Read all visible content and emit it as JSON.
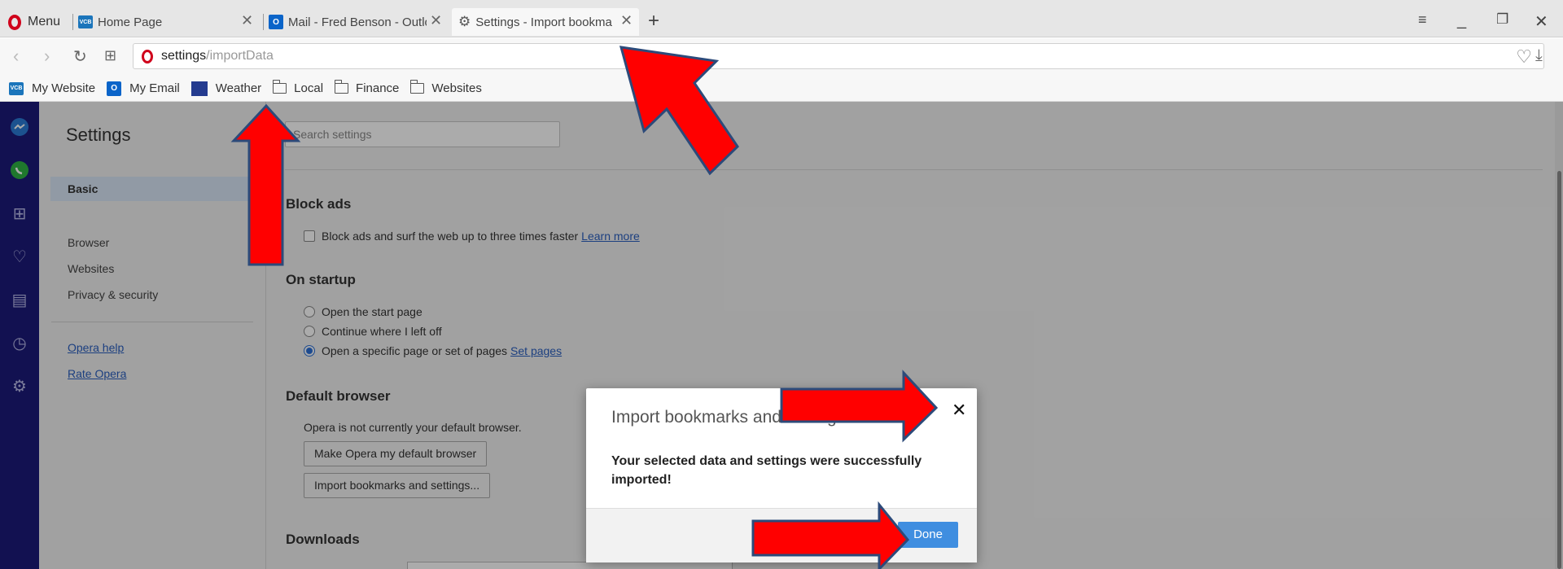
{
  "browser": {
    "menu_label": "Menu",
    "tabs": [
      {
        "label": "Home Page",
        "favicon": "vcb-icon",
        "favicon_text": "VCB"
      },
      {
        "label": "Mail - Fred Benson - Outlo",
        "favicon": "outlook-icon",
        "favicon_text": "O"
      },
      {
        "label": "Settings - Import bookma",
        "favicon": "gear-icon",
        "active": true
      }
    ],
    "address": {
      "host": "settings",
      "path": "/importData"
    },
    "bookmarks": [
      {
        "label": "My Website",
        "icon": "vcb-icon"
      },
      {
        "label": "My Email",
        "icon": "outlook-icon"
      },
      {
        "label": "Weather",
        "icon": "weather-icon"
      },
      {
        "label": "Local",
        "icon": "folder-icon"
      },
      {
        "label": "Finance",
        "icon": "folder-icon"
      },
      {
        "label": "Websites",
        "icon": "folder-icon"
      }
    ]
  },
  "settings": {
    "title": "Settings",
    "nav": {
      "basic": "Basic",
      "items": [
        "Browser",
        "Websites",
        "Privacy & security"
      ],
      "help_links": [
        "Opera help",
        "Rate Opera"
      ]
    },
    "search_placeholder": "Search settings",
    "block_ads": {
      "heading": "Block ads",
      "option": "Block ads and surf the web up to three times faster",
      "link": "Learn more"
    },
    "startup": {
      "heading": "On startup",
      "options": [
        "Open the start page",
        "Continue where I left off",
        "Open a specific page or set of pages"
      ],
      "selected_index": 2,
      "link": "Set pages"
    },
    "default_browser": {
      "heading": "Default browser",
      "status": "Opera is not currently your default browser.",
      "make_default_button": "Make Opera my default browser",
      "import_button": "Import bookmarks and settings..."
    },
    "downloads": {
      "heading": "Downloads"
    }
  },
  "dialog": {
    "title": "Import bookmarks and settings",
    "message": "Your selected data and settings were successfully imported!",
    "done_label": "Done"
  },
  "colors": {
    "sidebar": "#1c1a7a",
    "accent": "#3f8ee0",
    "annotation_arrow": "#ff0000",
    "annotation_outline": "#2c4a7a"
  }
}
